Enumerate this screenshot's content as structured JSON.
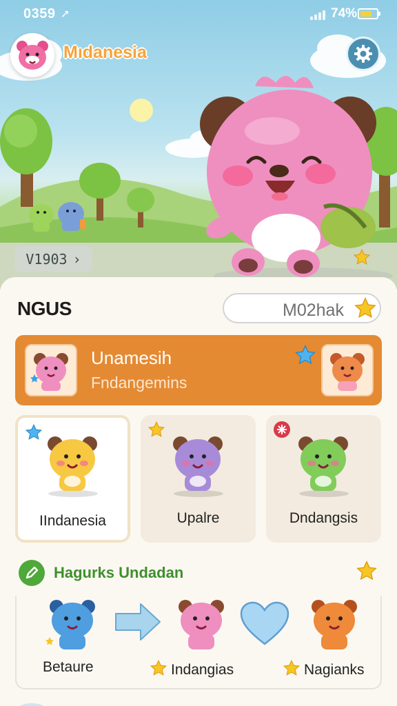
{
  "status": {
    "time": "0359",
    "battery_percent": "74%",
    "battery_level": 0.74,
    "signal_bars": 4
  },
  "header": {
    "app_title": "Mıdanesia",
    "settings_icon": "gear-icon"
  },
  "hero": {
    "level_chip": "Ѵ1 903",
    "level_chip_text": "V1903"
  },
  "section": {
    "title": "NGUS",
    "search_value": "M02hak"
  },
  "banner": {
    "title": "Unamesih",
    "subtitle": "Fndangemins"
  },
  "characters": [
    {
      "name": "IIndanesia",
      "color": "#f7c842",
      "selected": true,
      "corner_icon": "blue-star-icon"
    },
    {
      "name": "Upalre",
      "color": "#a88bd8",
      "selected": false,
      "corner_icon": "gold-star-icon"
    },
    {
      "name": "Dndangsis",
      "color": "#82cc5a",
      "selected": false,
      "corner_icon": "red-flower-icon"
    }
  ],
  "evolution": {
    "title": "Hagurks Undadan",
    "stages": [
      {
        "label": "Betaure",
        "starred": false
      },
      {
        "label": "Indangias",
        "starred": true
      },
      {
        "label": "Nagianks",
        "starred": true
      }
    ]
  },
  "colors": {
    "accent_orange": "#e48a33",
    "title_orange": "#f7a43a",
    "green": "#3f8f2c",
    "settings_blue": "#4a8fb1"
  }
}
